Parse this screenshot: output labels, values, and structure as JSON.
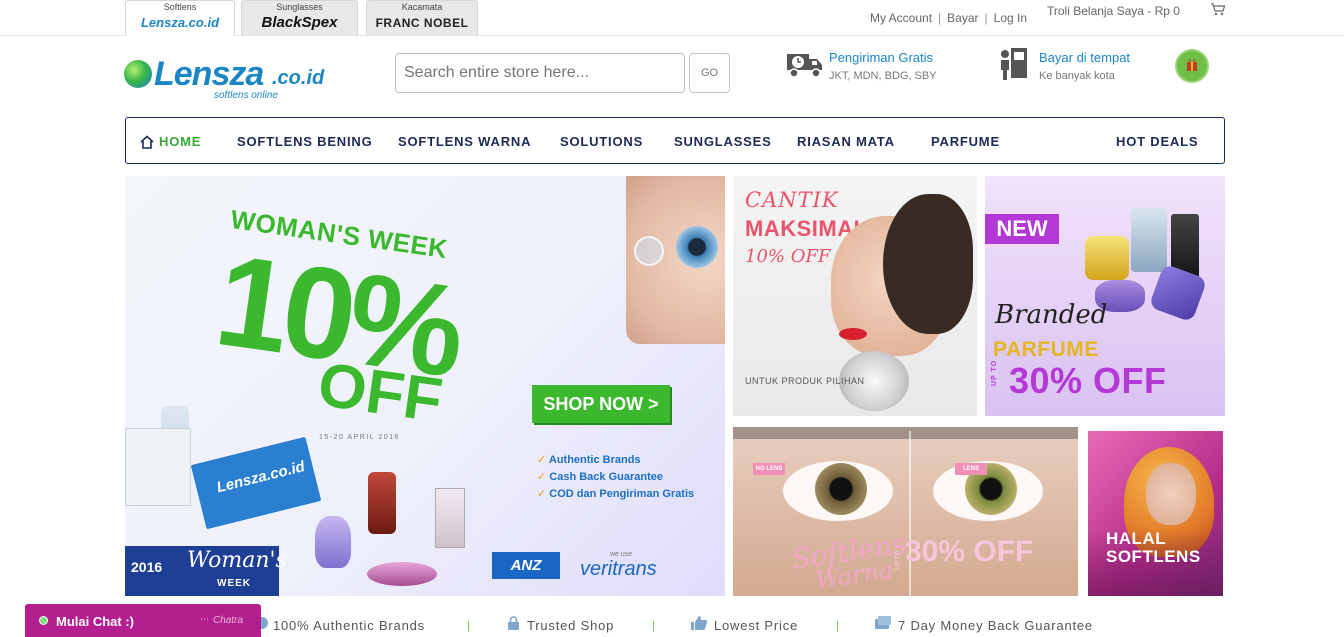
{
  "top_bar": {
    "store_tabs": [
      {
        "caption": "Softlens",
        "brand": "Lensza.co.id"
      },
      {
        "caption": "Sunglasses",
        "brand": "BlackSpex"
      },
      {
        "caption": "Kacamata",
        "brand": "FRANC NOBEL"
      }
    ],
    "links": [
      "My Account",
      "Bayar",
      "Log In"
    ],
    "separator": "|",
    "cart_label": "Troli Belanja Saya - Rp 0"
  },
  "header": {
    "logo_word": "Lensza",
    "logo_tld": ".co.id",
    "logo_tagline": "softlens online",
    "search_placeholder": "Search entire store here...",
    "search_button": "GO",
    "services": [
      {
        "title": "Pengiriman Gratis",
        "subtitle": "JKT, MDN, BDG, SBY",
        "icon": "truck-icon"
      },
      {
        "title": "Bayar di tempat",
        "subtitle": "Ke banyak kota",
        "icon": "cash-register-icon"
      }
    ]
  },
  "nav": {
    "items": [
      "HOME",
      "SOFTLENS BENING",
      "SOFTLENS WARNA",
      "SOLUTIONS",
      "SUNGLASSES",
      "RIASAN MATA",
      "PARFUME",
      "HOT DEALS"
    ]
  },
  "banners": {
    "main": {
      "headline": "WOMAN'S WEEK",
      "discount": "10%",
      "off": "OFF",
      "cta": "SHOP NOW >",
      "dates": "15-20 APRIL 2016",
      "bullets": [
        "Authentic Brands",
        "Cash Back Guarantee",
        "COD dan Pengiriman Gratis"
      ],
      "year": "2016",
      "week_line1": "Woman's",
      "week_line2": "WEEK",
      "box_brand": "Lensza.co.id",
      "partners": {
        "anz": "ANZ",
        "we_use": "we use",
        "veritrans": "veritrans"
      }
    },
    "cantik": {
      "line1": "CANTIK",
      "line2": "MAKSIMAL",
      "line3": "10% OFF",
      "note": "UNTUK PRODUK PILIHAN"
    },
    "parfume": {
      "badge": "NEW",
      "line1": "Branded",
      "line2": "PARFUME",
      "up_to": "UP TO",
      "discount": "30% OFF"
    },
    "softlens": {
      "tag_left": "NO LENS",
      "tag_right": "LENS",
      "script1": "Softlens",
      "script2": "Warna",
      "up_to": "UP TO",
      "discount": "30% OFF"
    },
    "halal": {
      "line1": "HALAL",
      "line2": "SOFTLENS"
    }
  },
  "features": [
    "100% Authentic Brands",
    "Trusted Shop",
    "Lowest Price",
    "7 Day Money Back Guarantee"
  ],
  "chat": {
    "label": "Mulai Chat :)",
    "powered": "Chatra"
  },
  "colors": {
    "brand_blue": "#1c86c4",
    "nav_navy": "#1d2a56",
    "home_green": "#36a937",
    "banner_green": "#3cb82e",
    "chat_magenta": "#b41e8f",
    "parfume_purple": "#b338d6"
  }
}
